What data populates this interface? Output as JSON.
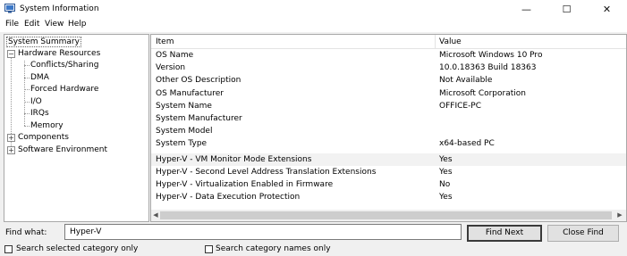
{
  "window": {
    "title": "System Information",
    "controls": {
      "minimize": "—",
      "maximize": "☐",
      "close": "✕"
    }
  },
  "menu": [
    "File",
    "Edit",
    "View",
    "Help"
  ],
  "tree": {
    "root": "System Summary",
    "hardware": "Hardware Resources",
    "hardware_children": [
      "Conflicts/Sharing",
      "DMA",
      "Forced Hardware",
      "I/O",
      "IRQs",
      "Memory"
    ],
    "components": "Components",
    "software": "Software Environment"
  },
  "table": {
    "headers": {
      "item": "Item",
      "value": "Value"
    },
    "rows_top": [
      {
        "item": "OS Name",
        "value": "Microsoft Windows 10 Pro"
      },
      {
        "item": "Version",
        "value": "10.0.18363 Build 18363"
      },
      {
        "item": "Other OS Description",
        "value": "Not Available"
      },
      {
        "item": "OS Manufacturer",
        "value": "Microsoft Corporation"
      },
      {
        "item": "System Name",
        "value": "OFFICE-PC"
      },
      {
        "item": "System Manufacturer",
        "value": ""
      },
      {
        "item": "System Model",
        "value": ""
      },
      {
        "item": "System Type",
        "value": "x64-based PC"
      }
    ],
    "rows_hyperv": [
      {
        "item": "Hyper-V - VM Monitor Mode Extensions",
        "value": "Yes"
      },
      {
        "item": "Hyper-V - Second Level Address Translation Extensions",
        "value": "Yes"
      },
      {
        "item": "Hyper-V - Virtualization Enabled in Firmware",
        "value": "No"
      },
      {
        "item": "Hyper-V - Data Execution Protection",
        "value": "Yes"
      }
    ]
  },
  "find": {
    "label": "Find what:",
    "value": "Hyper-V",
    "find_next": "Find Next",
    "close_find": "Close Find",
    "search_selected": "Search selected category only",
    "search_names": "Search category names only"
  }
}
